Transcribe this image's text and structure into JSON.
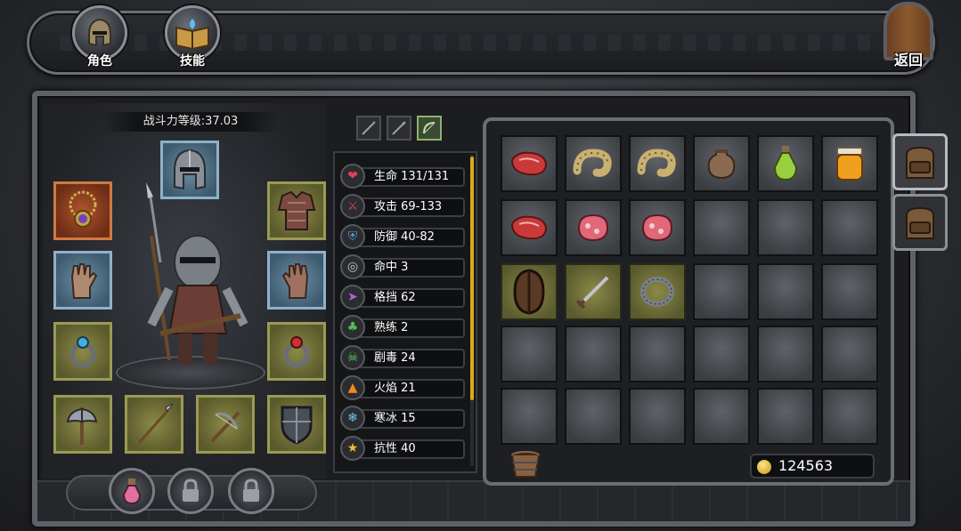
{
  "top_nav": {
    "character_label": "角色",
    "skills_label": "技能",
    "back_label": "返回"
  },
  "equipment": {
    "power_label": "战斗力等级:37.03"
  },
  "stats": [
    {
      "label": "生命",
      "value": "131/131",
      "icon": "heart-icon",
      "color": "#e0405a"
    },
    {
      "label": "攻击",
      "value": "69-133",
      "icon": "crossed-swords-icon",
      "color": "#d04848"
    },
    {
      "label": "防御",
      "value": "40-82",
      "icon": "shield-icon",
      "color": "#5aa0d8"
    },
    {
      "label": "命中",
      "value": "3",
      "icon": "target-icon",
      "color": "#c8c8c8"
    },
    {
      "label": "格挡",
      "value": "62",
      "icon": "dodge-runner-icon",
      "color": "#b060d8"
    },
    {
      "label": "熟练",
      "value": "2",
      "icon": "clover-icon",
      "color": "#50c050"
    },
    {
      "label": "剧毒",
      "value": "24",
      "icon": "poison-skull-icon",
      "color": "#60d060"
    },
    {
      "label": "火焰",
      "value": "21",
      "icon": "fire-icon",
      "color": "#f08a20"
    },
    {
      "label": "寒冰",
      "value": "15",
      "icon": "snowflake-icon",
      "color": "#70c8f0"
    },
    {
      "label": "抗性",
      "value": "40",
      "icon": "star-icon",
      "color": "#f0c030"
    }
  ],
  "inventory": {
    "gold": "124563",
    "rows": [
      [
        "raw-meat-icon",
        "sausage-icon",
        "sausage-icon",
        "clay-pot-icon",
        "green-potion-icon",
        "honey-jar-icon"
      ],
      [
        "raw-meat-icon",
        "meat-chunk-icon",
        "meat-chunk-icon",
        "",
        "",
        ""
      ],
      [
        "wooden-shield-icon",
        "sword-icon",
        "ring-icon",
        "",
        "",
        ""
      ],
      [
        "",
        "",
        "",
        "",
        "",
        ""
      ],
      [
        "",
        "",
        "",
        "",
        "",
        ""
      ]
    ]
  }
}
